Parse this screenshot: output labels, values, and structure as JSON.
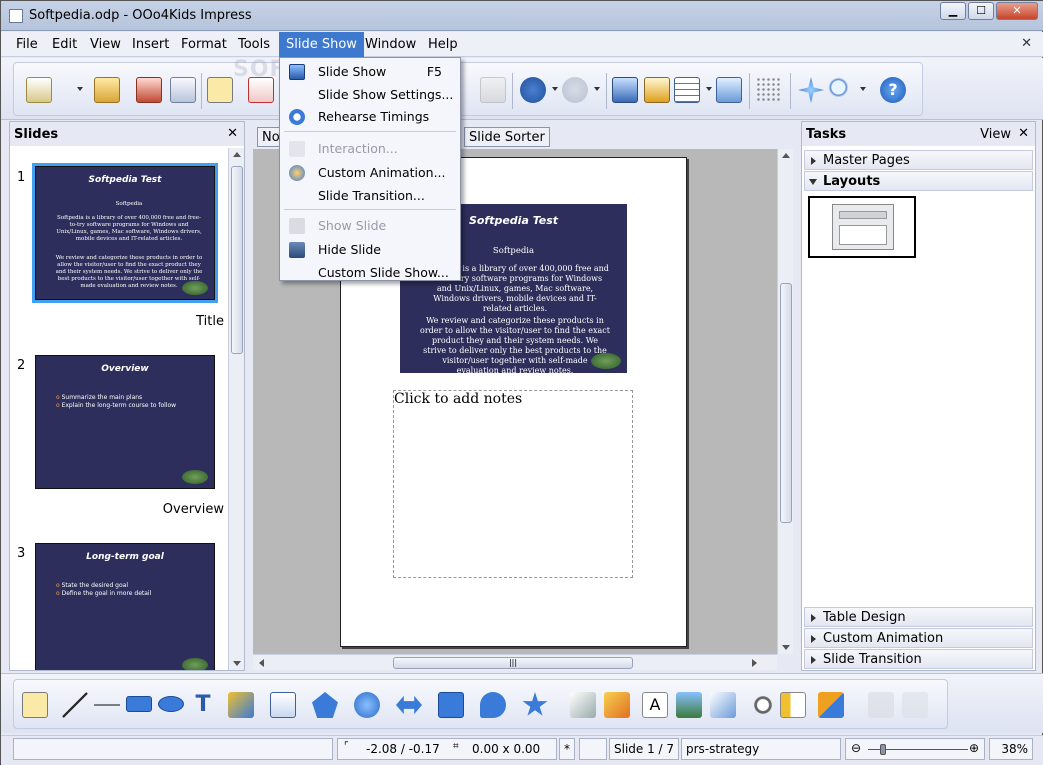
{
  "window": {
    "title": "Softpedia.odp - OOo4Kids Impress"
  },
  "menubar": {
    "items": [
      "File",
      "Edit",
      "View",
      "Insert",
      "Format",
      "Tools",
      "Slide Show",
      "Window",
      "Help"
    ],
    "close_glyph": "✕"
  },
  "watermark": "SOFTPEDIA",
  "slideshow_menu": {
    "items": [
      {
        "label": "Slide Show",
        "shortcut": "F5",
        "icon": "slideshow-icon",
        "enabled": true
      },
      {
        "label": "Slide Show Settings...",
        "icon": "",
        "enabled": true
      },
      {
        "label": "Rehearse Timings",
        "icon": "rehearse-icon",
        "enabled": true
      },
      {
        "label": "Interaction...",
        "icon": "interaction-icon",
        "enabled": false
      },
      {
        "label": "Custom Animation...",
        "icon": "animation-icon",
        "enabled": true
      },
      {
        "label": "Slide Transition...",
        "icon": "",
        "enabled": true
      },
      {
        "label": "Show Slide",
        "icon": "show-slide-icon",
        "enabled": false
      },
      {
        "label": "Hide Slide",
        "icon": "hide-slide-icon",
        "enabled": true
      },
      {
        "label": "Custom Slide Show...",
        "icon": "",
        "enabled": true
      }
    ]
  },
  "slides_panel": {
    "title": "Slides",
    "close_glyph": "✕",
    "slides": [
      {
        "number": "1",
        "caption": "Title",
        "thumb_title": "Softpedia Test",
        "thumb_sub": "Softpedia",
        "thumb_p1": "Softpedia is a library of over 400,000 free and free-to-try software programs for Windows and Unix/Linux, games, Mac software, Windows drivers, mobile devices and IT-related articles.",
        "thumb_p2": "We review and categorize these products in order to allow the visitor/user to find the exact product they and their system needs. We strive to deliver only the best products to the visitor/user together with self-made evaluation and review notes."
      },
      {
        "number": "2",
        "caption": "Overview",
        "thumb_title": "Overview",
        "bullets": [
          "Summarize the main plans",
          "Explain the long-term course to follow"
        ]
      },
      {
        "number": "3",
        "caption": "",
        "thumb_title": "Long-term goal",
        "bullets": [
          "State the desired goal",
          "Define the goal in more detail"
        ]
      }
    ]
  },
  "center": {
    "tabs": [
      "No",
      "Slide Sorter"
    ],
    "notes_slide": {
      "title": "Softpedia Test",
      "sub": "Softpedia",
      "p1": "Softpedia is a library of over 400,000 free and free-to-try software programs for Windows and Unix/Linux, games, Mac software, Windows drivers, mobile devices and IT-related articles.",
      "p2": "We review and categorize these products in order to allow the visitor/user to find the exact product they and their system needs. We strive to deliver only the best products to the visitor/user together with self-made evaluation and review notes."
    },
    "notes_placeholder": "Click to add notes"
  },
  "tasks_panel": {
    "title": "Tasks",
    "view_label": "View",
    "close_glyph": "✕",
    "sections_top": [
      "Master Pages",
      "Layouts"
    ],
    "sections_bottom": [
      "Table Design",
      "Custom Animation",
      "Slide Transition"
    ]
  },
  "statusbar": {
    "position": "-2.08 / -0.17",
    "size": "0.00 x 0.00",
    "modified": "*",
    "slide": "Slide 1 / 7",
    "master": "prs-strategy",
    "zoom": "38%"
  },
  "colors": {
    "accent": "#3c79cf",
    "slide_bg": "#2e2e5c",
    "selection": "#43a0f0"
  }
}
